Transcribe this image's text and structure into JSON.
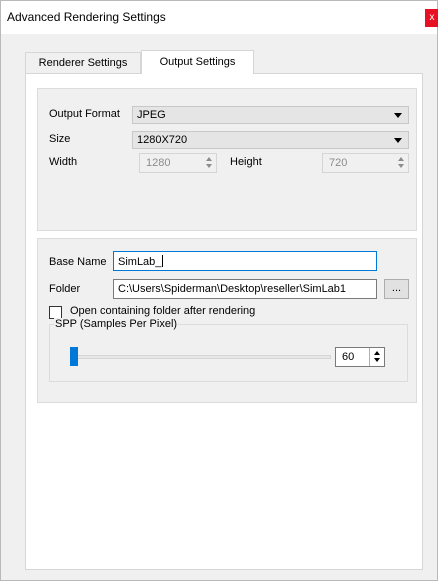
{
  "window": {
    "title": "Advanced Rendering Settings",
    "close_icon": "x"
  },
  "tabs": [
    {
      "label": "Renderer Settings",
      "active": false
    },
    {
      "label": "Output Settings",
      "active": true
    }
  ],
  "output": {
    "format_label": "Output Format",
    "format_value": "JPEG",
    "size_label": "Size",
    "size_value": "1280X720",
    "width_label": "Width",
    "width_value": "1280",
    "height_label": "Height",
    "height_value": "720"
  },
  "naming": {
    "base_name_label": "Base Name",
    "base_name_value": "SimLab_",
    "folder_label": "Folder",
    "folder_value": "C:\\Users\\Spiderman\\Desktop\\reseller\\SimLab1",
    "browse_label": "...",
    "open_folder_label": "Open containing folder after rendering",
    "open_folder_checked": false
  },
  "spp": {
    "group_label": "SPP (Samples Per Pixel)",
    "value": "60",
    "slider_fraction": 0.03
  },
  "colors": {
    "accent": "#0078d7",
    "close": "#e81123",
    "dialog_bg": "#f0f0f0"
  }
}
